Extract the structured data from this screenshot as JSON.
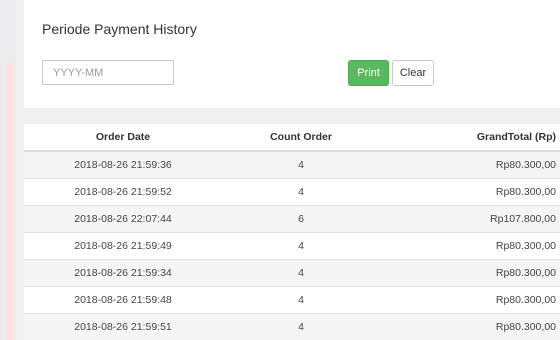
{
  "filter": {
    "title": "Periode Payment History",
    "period_placeholder": "YYYY-MM",
    "period_value": "",
    "print_label": "Print",
    "clear_label": "Clear"
  },
  "table": {
    "headers": [
      "Order Date",
      "Count Order",
      "GrandTotal (Rp)"
    ],
    "rows": [
      [
        "2018-08-26 21:59:36",
        "4",
        "Rp80.300,00"
      ],
      [
        "2018-08-26 21:59:52",
        "4",
        "Rp80.300,00"
      ],
      [
        "2018-08-26 22:07:44",
        "6",
        "Rp107.800,00"
      ],
      [
        "2018-08-26 21:59:49",
        "4",
        "Rp80.300,00"
      ],
      [
        "2018-08-26 21:59:34",
        "4",
        "Rp80.300,00"
      ],
      [
        "2018-08-26 21:59:48",
        "4",
        "Rp80.300,00"
      ],
      [
        "2018-08-26 21:59:51",
        "4",
        "Rp80.300,00"
      ]
    ]
  },
  "colors": {
    "print_button": "#5cb85c",
    "page_background": "#f0f0f3",
    "left_accent": "#fde0e0"
  }
}
